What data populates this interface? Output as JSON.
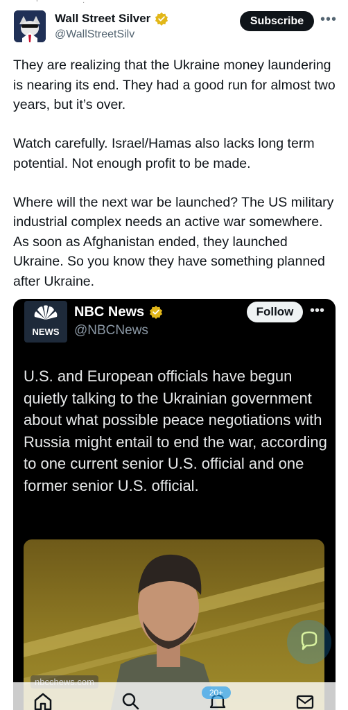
{
  "header": {
    "display_name": "Wall Street Silver",
    "handle": "@WallStreetSilv",
    "subscribe_label": "Subscribe",
    "more_label": "•••",
    "avatar_icon": "wolf-avatar-icon",
    "verified_icon": "gold-verified-badge-icon"
  },
  "tweet": {
    "paragraphs": [
      "They are realizing that the Ukraine money laundering is nearing its end. They had a good run for almost two years, but it’s over.",
      "Watch carefully. Israel/Hamas also lacks long term potential. Not enough profit to be made.",
      "Where will the next war be launched? The US military industrial complex needs an active war somewhere. As soon as Afghanistan ended, they launched Ukraine. So you know they have something planned after Ukraine."
    ]
  },
  "quoted": {
    "display_name": "NBC News",
    "handle": "@NBCNews",
    "logo_text": "NEWS",
    "follow_label": "Follow",
    "more_label": "•••",
    "text": "U.S. and European officials have begun quietly talking to the Ukrainian government about what possible peace negotiations with Russia might entail to end the war, according to one current senior U.S. official and one former senior U.S. official.",
    "image": {
      "source_label": "nbcchews.com"
    }
  },
  "bottom_nav": {
    "items": [
      "home-icon",
      "search-icon",
      "notifications-icon",
      "messages-icon"
    ],
    "notification_badge": "20+"
  },
  "colors": {
    "text_primary": "#0f1419",
    "text_secondary": "#536471",
    "accent": "#1d9bf0",
    "verified_gold": "#e2b719",
    "card_bg": "#000000"
  }
}
